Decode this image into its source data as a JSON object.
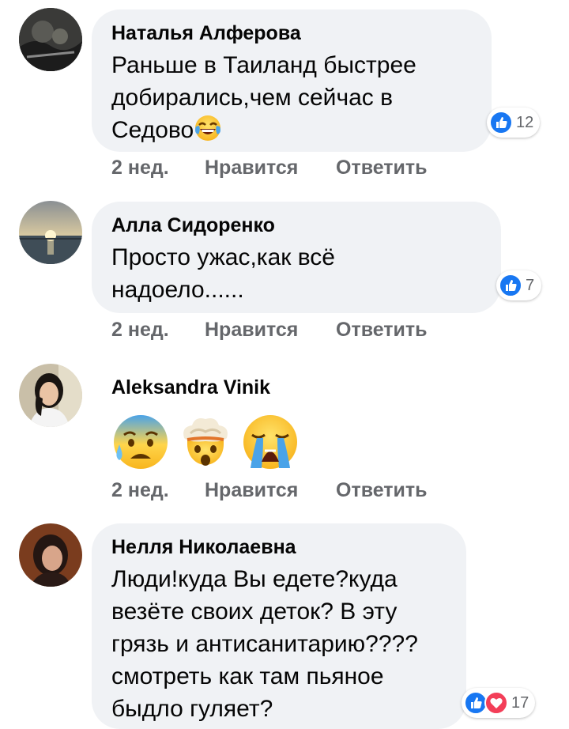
{
  "colors": {
    "bubble": "#f0f2f5",
    "meta_text": "#65676b",
    "like_blue": "#1877f2",
    "love_red": "#f33e58"
  },
  "comments": [
    {
      "author": "Наталья Алферова",
      "text": "Раньше в Таиланд быстрее\nдобирались,чем сейчас в\nСедово",
      "trailing_emoji": "face-with-tears-of-joy",
      "time": "2 нед.",
      "like_label": "Нравится",
      "reply_label": "Ответить",
      "reaction_count": "12",
      "reaction_icons": [
        "like-icon"
      ]
    },
    {
      "author": "Алла Сидоренко",
      "text": "Просто ужас,как всё\nнадоело......",
      "time": "2 нед.",
      "like_label": "Нравится",
      "reply_label": "Ответить",
      "reaction_count": "7",
      "reaction_icons": [
        "like-icon"
      ]
    },
    {
      "author": "Aleksandra Vinik",
      "emojis": [
        "anxious-face-with-sweat",
        "exploding-head",
        "loudly-crying-face"
      ],
      "time": "2 нед.",
      "like_label": "Нравится",
      "reply_label": "Ответить"
    },
    {
      "author": "Нелля Николаевна",
      "text": "Люди!куда Вы едете?куда\nвезёте своих деток? В эту\nгрязь и антисанитарию????\nсмотреть как там пьяное\nбыдло гуляет?",
      "reaction_count": "17",
      "reaction_icons": [
        "like-icon",
        "love-icon"
      ]
    }
  ]
}
